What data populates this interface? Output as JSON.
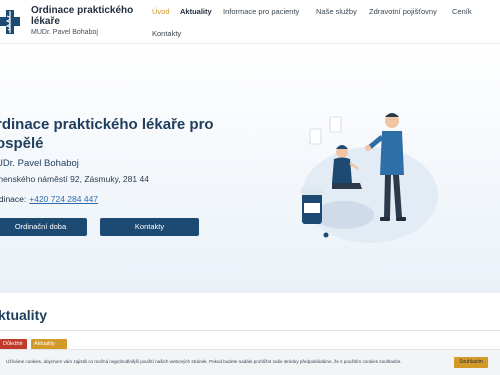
{
  "brand": {
    "title": "Ordinace praktického lékaře",
    "doctor": "MUDr. Pavel Bohaboj",
    "accent": "#d39a2a",
    "primary": "#1d4a72"
  },
  "nav": {
    "items": [
      {
        "label": "Úvod"
      },
      {
        "label": "Aktuality"
      },
      {
        "label": "Informace pro pacienty"
      },
      {
        "label": "Naše služby"
      },
      {
        "label": "Zdravotní pojišťovny"
      },
      {
        "label": "Ceník"
      },
      {
        "label": "Kontakty"
      }
    ]
  },
  "hero": {
    "title_line1": "rdinace praktického lékaře pro",
    "title_line2": "ospělé",
    "name": "UDr. Pavel Bohaboj",
    "address": "menského náměstí 92, Zásmuky, 281 44",
    "phone_label": "rdinace:",
    "phone": "+420 724 284 447",
    "btn_hours": "Ordinační doba",
    "btn_contacts": "Kontakty"
  },
  "news": {
    "title": "ktuality",
    "tag_important": "Důležité",
    "tag_news": "Aktuality"
  },
  "cookie": {
    "text": "Užíváme cookies, abychom vám zajistili co možná nejpohodlnější použití našich webových stránek. Pokud budete nadále prohlížet naše stránky předpokládáme, že s použitím cookies souhlasíte.",
    "button": "Souhlasím"
  }
}
